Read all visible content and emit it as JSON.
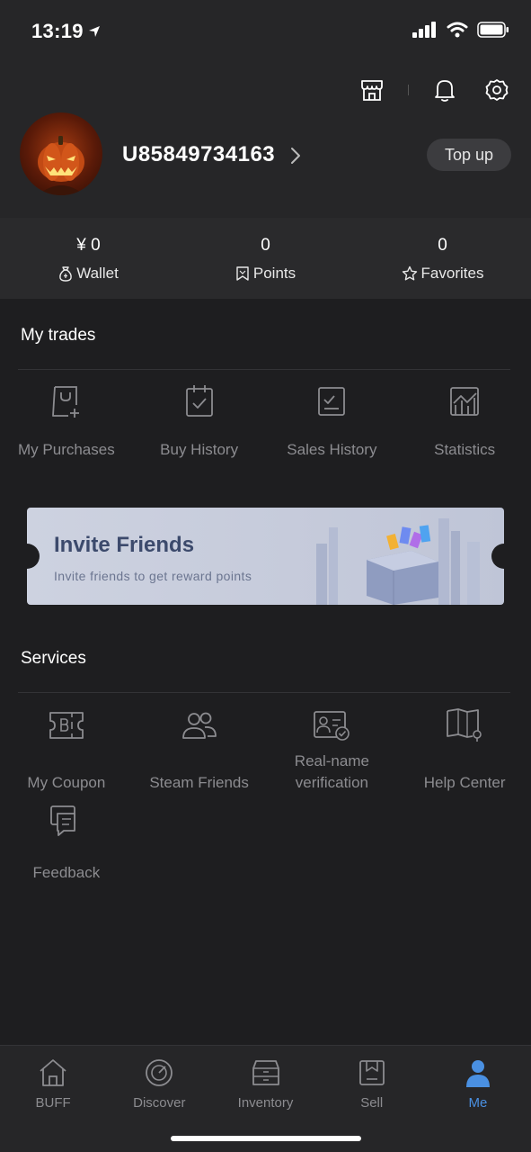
{
  "status_bar": {
    "time": "13:19"
  },
  "profile": {
    "username": "U85849734163",
    "topup_label": "Top up"
  },
  "stats": [
    {
      "value": "¥ 0",
      "label": "Wallet",
      "icon": "wallet-icon"
    },
    {
      "value": "0",
      "label": "Points",
      "icon": "points-icon"
    },
    {
      "value": "0",
      "label": "Favorites",
      "icon": "star-icon"
    }
  ],
  "trades": {
    "title": "My trades",
    "items": [
      {
        "label": "My Purchases",
        "icon": "shopping-bag-icon"
      },
      {
        "label": "Buy History",
        "icon": "calendar-check-icon"
      },
      {
        "label": "Sales History",
        "icon": "document-list-icon"
      },
      {
        "label": "Statistics",
        "icon": "chart-icon"
      }
    ]
  },
  "banner": {
    "title": "Invite Friends",
    "subtitle": "Invite friends to get reward points"
  },
  "services": {
    "title": "Services",
    "items": [
      {
        "label": "My Coupon",
        "icon": "coupon-icon"
      },
      {
        "label": "Steam Friends",
        "icon": "friends-icon"
      },
      {
        "label_line1": "Real-name",
        "label_line2": "verification",
        "icon": "id-card-icon"
      },
      {
        "label": "Help Center",
        "icon": "help-book-icon"
      },
      {
        "label": "Feedback",
        "icon": "feedback-icon"
      }
    ]
  },
  "bottom_nav": [
    {
      "label": "BUFF",
      "icon": "home-icon"
    },
    {
      "label": "Discover",
      "icon": "discover-icon"
    },
    {
      "label": "Inventory",
      "icon": "inventory-icon"
    },
    {
      "label": "Sell",
      "icon": "sell-icon"
    },
    {
      "label": "Me",
      "icon": "me-icon",
      "active": true
    }
  ],
  "colors": {
    "accent": "#4a90e2",
    "background": "#1e1e20",
    "header": "#262628",
    "banner_title": "#3c4a6c"
  }
}
